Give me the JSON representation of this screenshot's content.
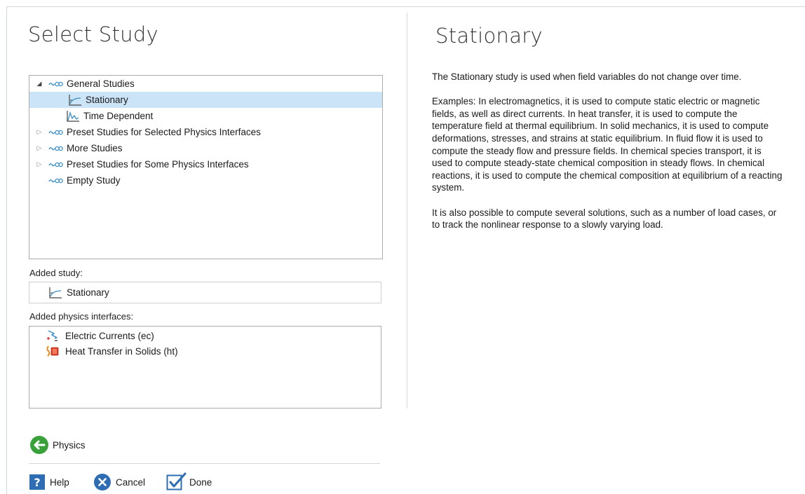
{
  "wizard": {
    "left_title": "Select Study",
    "right_title": "Stationary"
  },
  "tree": {
    "items": [
      {
        "label": "General Studies",
        "icon": "study-group-icon",
        "expanded": true
      },
      {
        "label": "Stationary",
        "icon": "stationary-icon",
        "selected": true
      },
      {
        "label": "Time Dependent",
        "icon": "time-dependent-icon"
      },
      {
        "label": "Preset Studies for Selected Physics Interfaces",
        "icon": "study-group-icon",
        "expanded": false
      },
      {
        "label": "More Studies",
        "icon": "study-group-icon",
        "expanded": false
      },
      {
        "label": "Preset Studies for Some Physics Interfaces",
        "icon": "study-group-icon",
        "expanded": false
      },
      {
        "label": "Empty Study",
        "icon": "study-group-icon"
      }
    ]
  },
  "added_study": {
    "label": "Added study:",
    "value": "Stationary",
    "icon": "stationary-icon"
  },
  "added_physics": {
    "label": "Added physics interfaces:",
    "items": [
      {
        "label": "Electric Currents (ec)",
        "icon": "electric-currents-icon"
      },
      {
        "label": "Heat Transfer in Solids (ht)",
        "icon": "heat-transfer-icon"
      }
    ]
  },
  "description": {
    "paragraphs": [
      "The Stationary study is used when field variables do not change over time.",
      "Examples: In electromagnetics, it is used to compute static electric or magnetic fields, as well as direct currents. In heat transfer, it is used to compute the temperature field at thermal equilibrium. In solid mechanics, it is used to compute deformations, stresses, and strains at static equilibrium. In fluid flow it is used to compute the steady flow and pressure fields. In chemical species transport, it is used to compute steady-state chemical composition in steady flows. In chemical reactions, it is used to compute the chemical composition at equilibrium of a reacting system.",
      "It is also possible to compute several solutions, such as a number of load cases, or to track the nonlinear response to a slowly varying load."
    ]
  },
  "nav": {
    "back_label": "Physics",
    "back_icon": "arrow-left-icon"
  },
  "buttons": {
    "help": "Help",
    "cancel": "Cancel",
    "done": "Done"
  },
  "colors": {
    "selection": "#cce4f7",
    "accent_blue": "#2e6db4",
    "nav_green": "#3aa13a",
    "study_icon": "#3a8fc9"
  }
}
